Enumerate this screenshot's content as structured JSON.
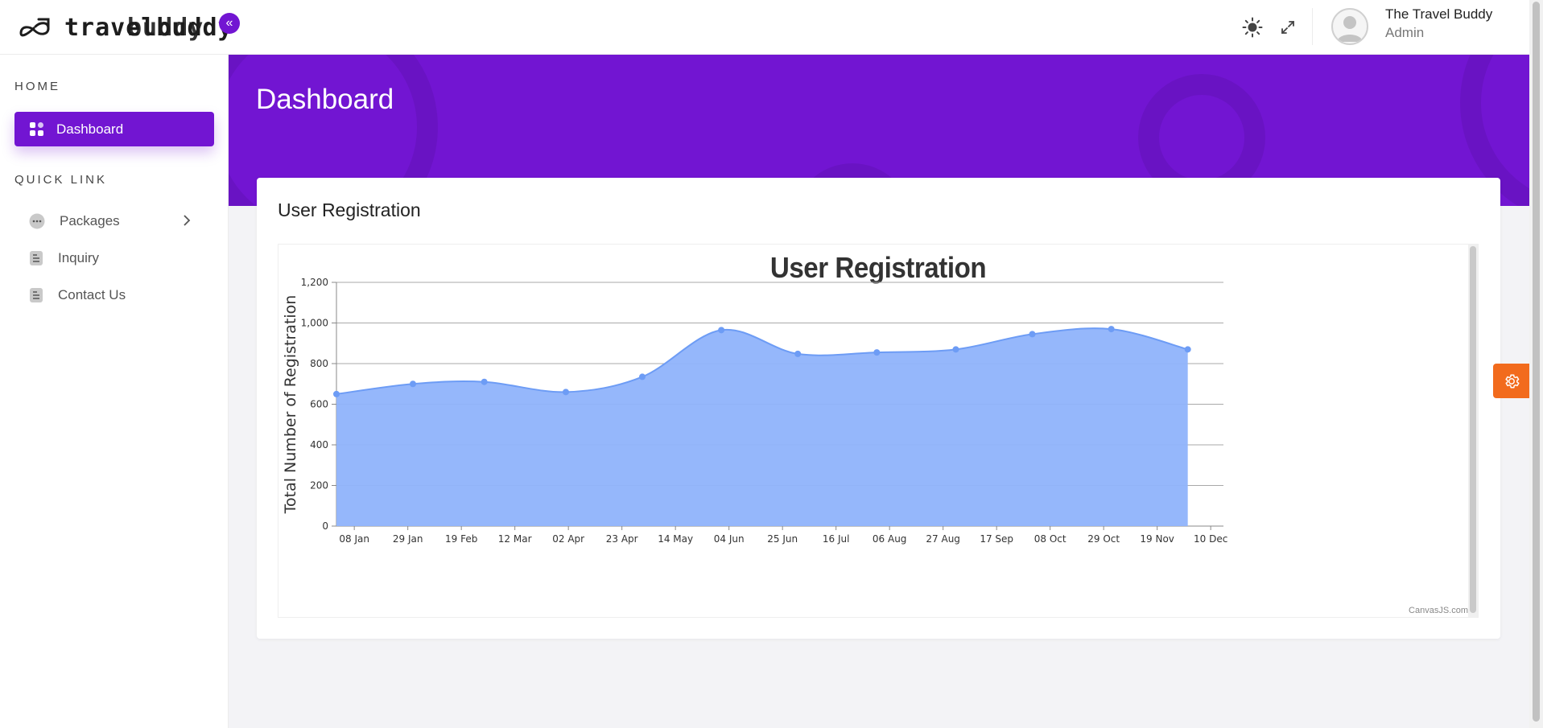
{
  "app": {
    "logo_text": "travelbuddy",
    "logo_text_overlap": "buddy"
  },
  "header": {
    "user_name": "The Travel Buddy",
    "user_role": "Admin"
  },
  "sidebar": {
    "home_title": "HOME",
    "quick_link_title": "QUICK LINK",
    "items": [
      {
        "label": "Dashboard",
        "active": true
      },
      {
        "label": "Packages",
        "active": false
      },
      {
        "label": "Inquiry",
        "active": false
      },
      {
        "label": "Contact Us",
        "active": false
      }
    ]
  },
  "main": {
    "page_title": "Dashboard",
    "card_title": "User Registration"
  },
  "colors": {
    "accent": "#7215d2",
    "area_fill": "#8fb3fb",
    "area_line": "#6d9cf5",
    "settings": "#f26b1d"
  },
  "chart_data": {
    "type": "area",
    "title": "User Registration",
    "xlabel": "",
    "ylabel": "Total Number of Registration",
    "ylim": [
      0,
      1200
    ],
    "yticks": [
      0,
      200,
      400,
      600,
      800,
      1000,
      1200
    ],
    "xlim": [
      "2020-01-01",
      "2020-12-14"
    ],
    "xtick_labels": [
      "08 Jan",
      "29 Jan",
      "19 Feb",
      "12 Mar",
      "02 Apr",
      "23 Apr",
      "14 May",
      "04 Jun",
      "25 Jun",
      "16 Jul",
      "06 Aug",
      "27 Aug",
      "17 Sep",
      "08 Oct",
      "29 Oct",
      "19 Nov",
      "10 Dec"
    ],
    "x": [
      "2020-01-01",
      "2020-01-31",
      "2020-02-28",
      "2020-03-31",
      "2020-04-30",
      "2020-05-31",
      "2020-06-30",
      "2020-07-31",
      "2020-08-31",
      "2020-09-30",
      "2020-10-31",
      "2020-11-30"
    ],
    "series": [
      {
        "values": [
          650,
          700,
          710,
          660,
          735,
          965,
          848,
          855,
          870,
          945,
          970,
          870
        ]
      }
    ],
    "grid": true,
    "credit": "CanvasJS.com"
  }
}
